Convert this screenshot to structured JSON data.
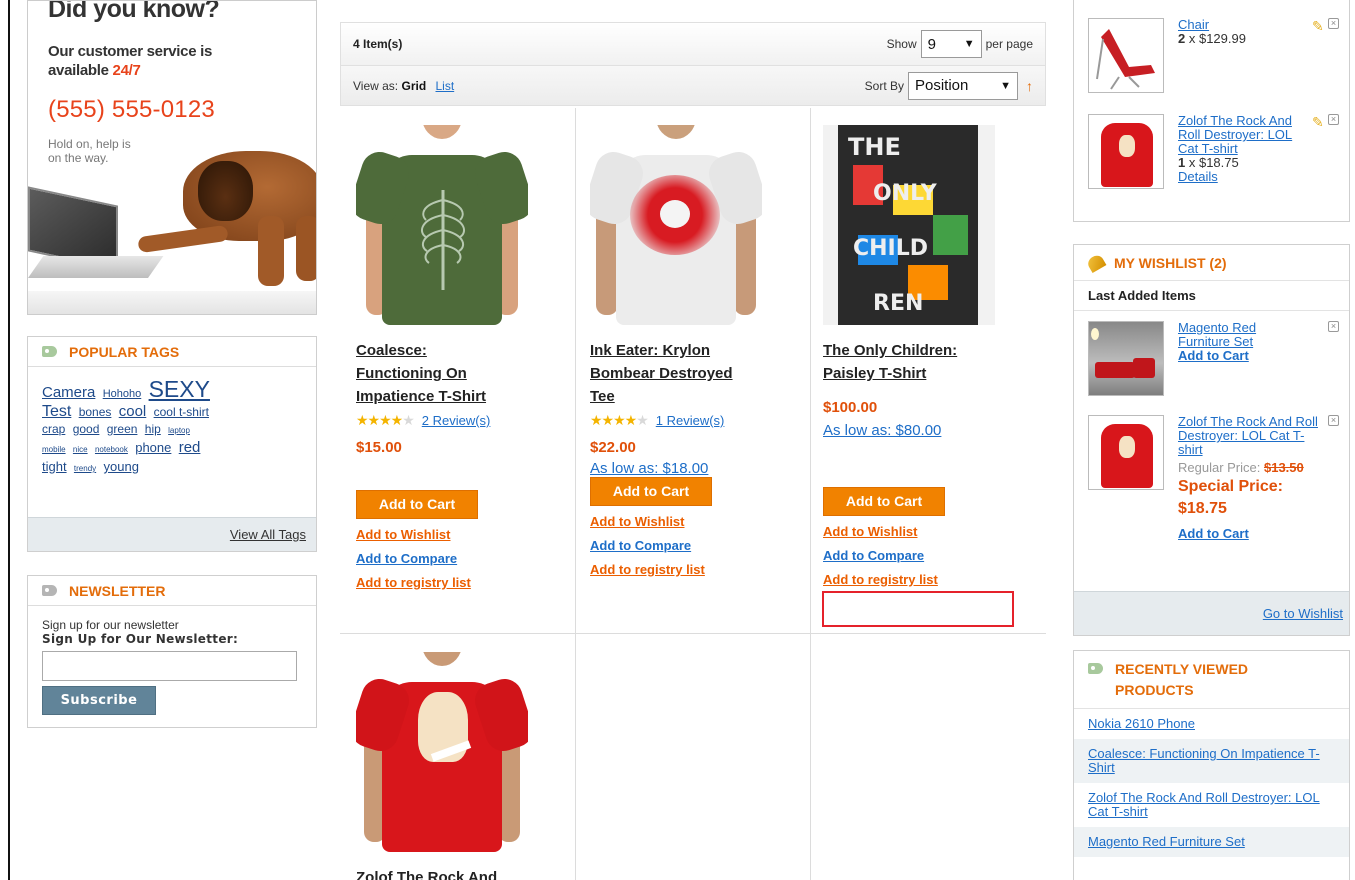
{
  "promo": {
    "title": "Did you know?",
    "line1": "Our customer service is",
    "line2_pre": "available ",
    "line2_hl": "24/7",
    "phone": "(555) 555-0123",
    "small1": "Hold on, help is",
    "small2": "on the way."
  },
  "tags_block": {
    "title": "POPULAR TAGS",
    "tags": [
      "Camera",
      "Hohoho",
      "SEXY",
      "Test",
      "bones",
      "cool",
      "cool t-shirt",
      "crap",
      "good",
      "green",
      "hip",
      "laptop",
      "mobile",
      "nice",
      "notebook",
      "phone",
      "red",
      "tight",
      "trendy",
      "young"
    ],
    "view_all": "View All Tags"
  },
  "newsletter": {
    "title": "NEWSLETTER",
    "text1": "Sign up for our newsletter",
    "text2": "Sign Up for Our Newsletter:",
    "input_value": "",
    "button": "Subscribe"
  },
  "toolbar": {
    "count": "4 Item(s)",
    "show_label": "Show",
    "show_value": "9",
    "per_page": "per page",
    "view_as_label": "View as:",
    "view_grid": "Grid",
    "view_list": "List",
    "sort_label": "Sort By",
    "sort_value": "Position"
  },
  "products": [
    {
      "name_l1": "Coalesce:",
      "name_l2": "Functioning On",
      "name_l3": "Impatience T-Shirt",
      "stars": 4,
      "reviews": "2 Review(s)",
      "price": "$15.00",
      "as_low": "",
      "add_to_cart": "Add to Cart",
      "wishlist": "Add to Wishlist",
      "compare": "Add to Compare",
      "registry": "Add to registry list",
      "shirt_color": "#4e6b3a"
    },
    {
      "name_l1": "Ink Eater: Krylon",
      "name_l2": "Bombear Destroyed",
      "name_l3": "Tee",
      "stars": 4,
      "reviews": "1 Review(s)",
      "price": "$22.00",
      "as_low": "As low as: $18.00",
      "add_to_cart": "Add to Cart",
      "wishlist": "Add to Wishlist",
      "compare": "Add to Compare",
      "registry": "Add to registry list",
      "shirt_color": "#ececec"
    },
    {
      "name_l1": "The Only Children:",
      "name_l2": "Paisley T-Shirt",
      "name_l3": "",
      "stars": 0,
      "reviews": "",
      "price": "$100.00",
      "as_low": "As low as: $80.00",
      "add_to_cart": "Add to Cart",
      "wishlist": "Add to Wishlist",
      "compare": "Add to Compare",
      "registry": "Add to registry list",
      "shirt_color": "#f2f2f2"
    },
    {
      "name_l1": "Zolof The Rock And",
      "shirt_color": "#d8161b"
    }
  ],
  "cart": {
    "item1_name": "Chair",
    "item1_qty": "2",
    "item1_price": " x $129.99",
    "item2_name": "Zolof The Rock And Roll Destroyer: LOL Cat T-shirt",
    "item2_qty": "1",
    "item2_price": " x $18.75",
    "item2_details": "Details"
  },
  "wishlist": {
    "title": "MY WISHLIST (2)",
    "sub": "Last Added Items",
    "item1_name": "Magento Red Furniture Set",
    "item1_cart": "Add to Cart",
    "item2_name": "Zolof The Rock And Roll Destroyer: LOL Cat T-shirt",
    "item2_regular_label": "Regular Price: ",
    "item2_regular": "$13.50",
    "item2_special_label": "Special Price:",
    "item2_special": "$18.75",
    "item2_cart": "Add to Cart",
    "go_to": "Go to Wishlist"
  },
  "recent": {
    "title_l1": "RECENTLY VIEWED",
    "title_l2": "PRODUCTS",
    "items": [
      "Nokia 2610 Phone",
      "Coalesce: Functioning On Impatience T-Shirt",
      "Zolof The Rock And Roll Destroyer: LOL Cat T-shirt",
      "Magento Red Furniture Set"
    ]
  },
  "colors": {
    "accent_orange": "#e36c0a",
    "link_blue": "#1e6ec8",
    "button_orange": "#f18200",
    "highlight_red": "#e5222b"
  }
}
